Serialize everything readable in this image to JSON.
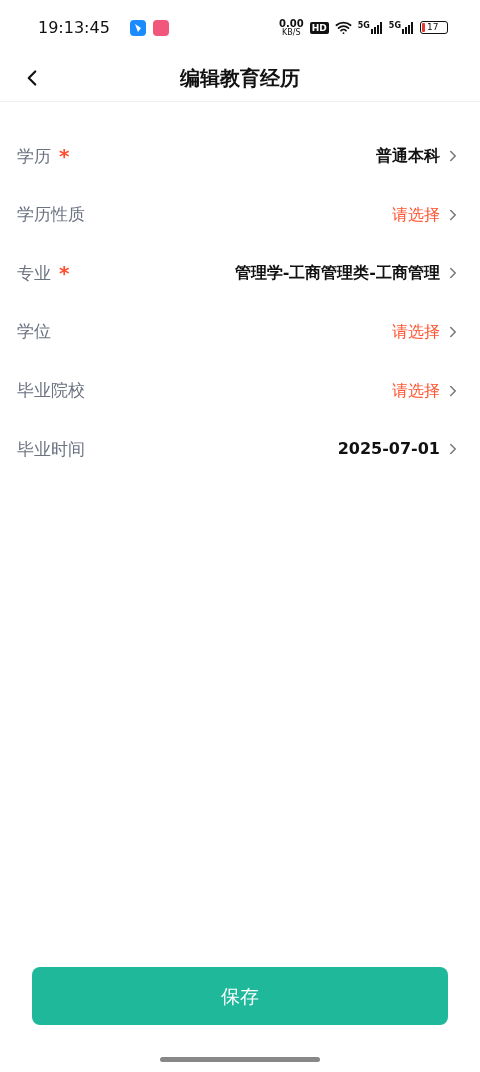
{
  "status_bar": {
    "time": "19:13:45",
    "net_speed": "0.00",
    "net_unit": "KB/S",
    "hd": "HD",
    "signal_labels": [
      "5G",
      "5G"
    ],
    "battery": "17"
  },
  "header": {
    "title": "编辑教育经历"
  },
  "fields": [
    {
      "label": "学历",
      "mark": "*",
      "value": "普通本科"
    },
    {
      "label": "学历性质",
      "placeholder": "请选择"
    },
    {
      "label": "专业",
      "mark": "*",
      "value": "管理学-工商管理类-工商管理"
    },
    {
      "label": "学位",
      "placeholder": "请选择"
    },
    {
      "label": "毕业院校",
      "placeholder": "请选择"
    },
    {
      "label": "毕业时间",
      "value": "2025-07-01"
    }
  ],
  "save_button": "保存"
}
